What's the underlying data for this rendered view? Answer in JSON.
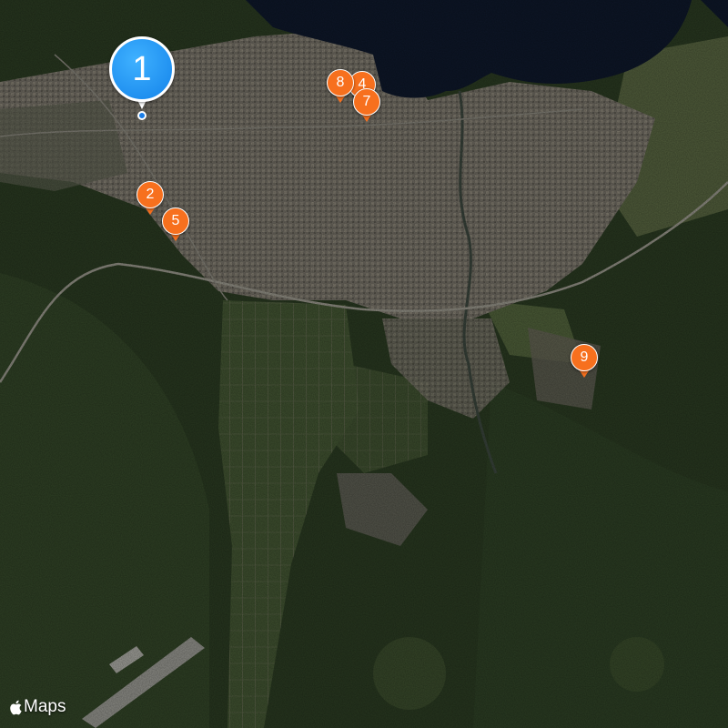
{
  "map": {
    "type": "satellite",
    "attribution": "Maps",
    "colors": {
      "water": "#0d1627",
      "forest": "#2c3a22",
      "urban": "#6e6a62",
      "farmland": "#3e5030",
      "primary_pin": "#1a8cf0",
      "secondary_pin": "#f7701e"
    }
  },
  "pins": [
    {
      "id": "pin-1",
      "label": "1",
      "style": "primary"
    },
    {
      "id": "pin-2",
      "label": "2",
      "style": "secondary"
    },
    {
      "id": "pin-5",
      "label": "5",
      "style": "secondary"
    },
    {
      "id": "pin-8",
      "label": "8",
      "style": "secondary"
    },
    {
      "id": "pin-4",
      "label": "4",
      "style": "secondary"
    },
    {
      "id": "pin-7",
      "label": "7",
      "style": "secondary"
    },
    {
      "id": "pin-9",
      "label": "9",
      "style": "secondary"
    }
  ]
}
